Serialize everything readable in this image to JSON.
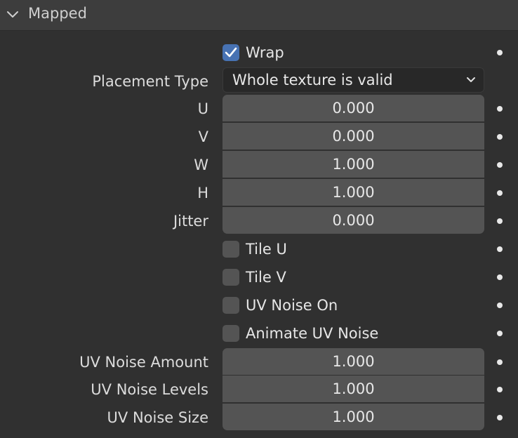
{
  "panel": {
    "title": "Mapped",
    "expanded": true,
    "chevron_icon": "chevron-down-icon"
  },
  "wrap": {
    "label": "Wrap",
    "checked": true
  },
  "placement_type": {
    "label": "Placement Type",
    "value": "Whole texture is valid"
  },
  "fields": [
    {
      "label": "U",
      "value": "0.000"
    },
    {
      "label": "V",
      "value": "0.000"
    },
    {
      "label": "W",
      "value": "1.000"
    },
    {
      "label": "H",
      "value": "1.000"
    },
    {
      "label": "Jitter",
      "value": "0.000"
    }
  ],
  "checkboxes": [
    {
      "label": "Tile U",
      "checked": false
    },
    {
      "label": "Tile V",
      "checked": false
    },
    {
      "label": "UV Noise On",
      "checked": false
    },
    {
      "label": "Animate UV Noise",
      "checked": false
    }
  ],
  "noise_fields": [
    {
      "label": "UV Noise Amount",
      "value": "1.000"
    },
    {
      "label": "UV Noise Levels",
      "value": "1.000"
    },
    {
      "label": "UV Noise Size",
      "value": "1.000"
    }
  ],
  "colors": {
    "background": "#303030",
    "header": "#3d3d3d",
    "field": "#545454",
    "dropdown": "#282828",
    "accent": "#4772b3"
  }
}
